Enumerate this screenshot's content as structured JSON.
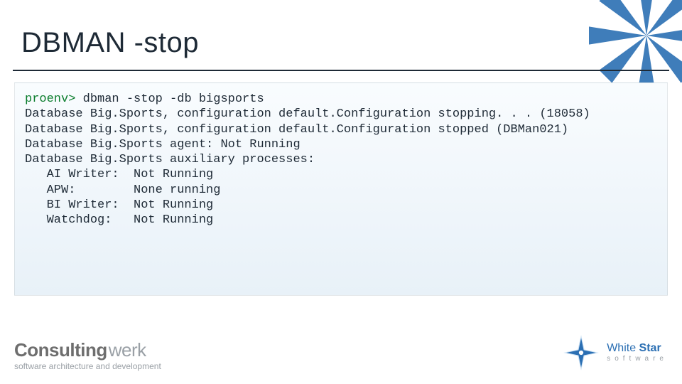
{
  "title": "DBMAN -stop",
  "terminal": {
    "prompt": "proenv>",
    "command": "dbman -stop -db bigsports",
    "blank1": "",
    "line_stopping": "Database Big.Sports, configuration default.Configuration stopping. . . (18058)",
    "line_stopped": "Database Big.Sports, configuration default.Configuration stopped (DBMan021)",
    "blank2": "",
    "line_agent": "Database Big.Sports agent: Not Running",
    "blank3": "",
    "line_auxhdr": "Database Big.Sports auxiliary processes:",
    "line_ai": "   AI Writer:  Not Running",
    "line_apw": "   APW:        None running",
    "line_bi": "   BI Writer:  Not Running",
    "line_wd": "   Watchdog:   Not Running"
  },
  "footer": {
    "consultingwerk": {
      "strong": "Consulting",
      "light": "werk",
      "tagline": "software architecture and development"
    },
    "whitestar": {
      "line1_light": "White ",
      "line1_bold": "Star",
      "line2": "software"
    }
  }
}
